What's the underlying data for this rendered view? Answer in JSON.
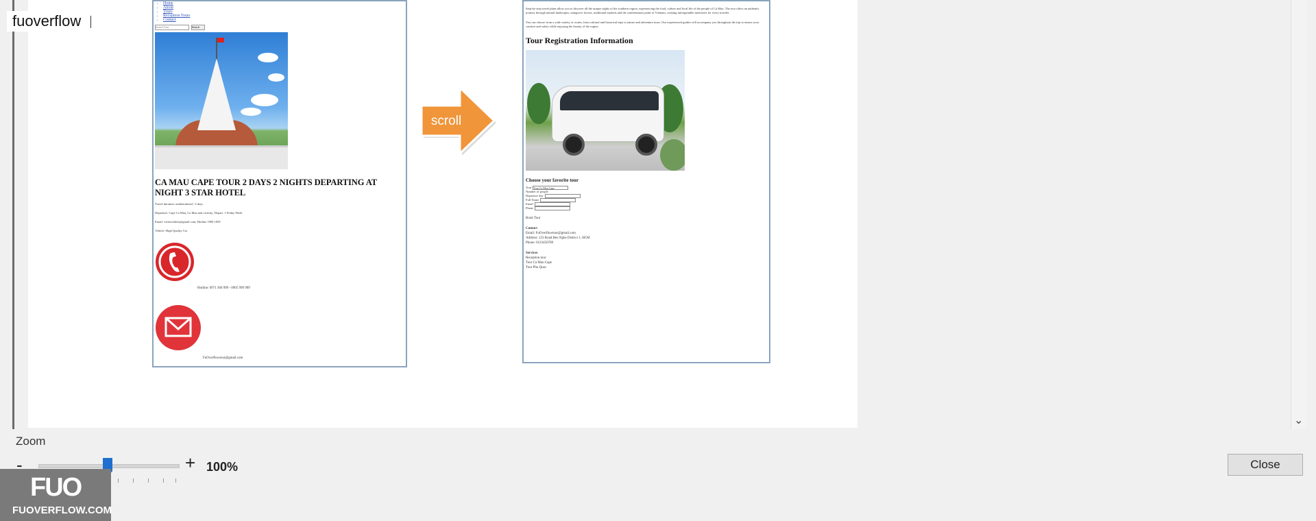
{
  "overlay": {
    "label": "fuoverflow"
  },
  "left_page": {
    "nav_items": [
      "Home",
      "About",
      "Tours",
      "Reception Tours",
      "Contact"
    ],
    "search_placeholder": "Search Tour",
    "search_button": "Search",
    "tour_title": "CA MAU CAPE TOUR 2 DAYS 2 NIGHTS DEPARTING AT NIGHT 3 STAR HOTEL",
    "details": [
      "Travel duration: undetermined / 2 days",
      "Departure: Cape Ca Mau, Ca Mau and vicinity; Depart: 1 Friday Week",
      "Email: vietravelinfo@gmail.com; Hotline 1900 1839",
      "Vehicle: High Quality Car"
    ],
    "hotline": "Hotline: 0971 366 999 - 0905 999 999",
    "email": "FuOverflowtour@gmail.com"
  },
  "arrow": {
    "label": "scroll",
    "color": "#f0953a"
  },
  "right_page": {
    "intro": "Step-by-step travel plans allow you to discover all the unique sights of the southern region, experiencing the food, culture and local life of the people of Ca Mau. The tour offers an authentic journey through natural landscapes, mangrove forests, traditional markets and the southernmost point of Vietnam, creating unforgettable memories for every traveler.",
    "intro2": "You can choose from a wide variety of routes, from cultural and historical trips to nature and adventure tours. Our experienced guides will accompany you throughout the trip to ensure your comfort and safety while enjoying the beauty of the region.",
    "heading": "Tour Registration Information",
    "choose_label": "Choose your favorite tour",
    "form_fields": [
      "Tour",
      "Number of people",
      "Departure day",
      "Full Name",
      "Email",
      "Phone"
    ],
    "tour_select_value": "Tour Ca Mau Cape",
    "book_label": "Book Tour",
    "contact_heading": "Contact",
    "contact_email": "Email: FuOverflowtour@gmail.com",
    "contact_address": "Address: 123 Road Ben Nghe District 1, HCM",
    "contact_phone": "Phone: 0123456789",
    "services_heading": "Services",
    "service_items": [
      "Reception tour",
      "Tour Ca Mau Cape",
      "Tour Phu Quoc"
    ]
  },
  "bottom": {
    "zoom_label": "Zoom",
    "minus": "-",
    "plus": "+",
    "zoom_value": "100%",
    "close_label": "Close"
  },
  "brand": {
    "logo": "FUO",
    "text": "FUOVERFLOW.COM"
  }
}
